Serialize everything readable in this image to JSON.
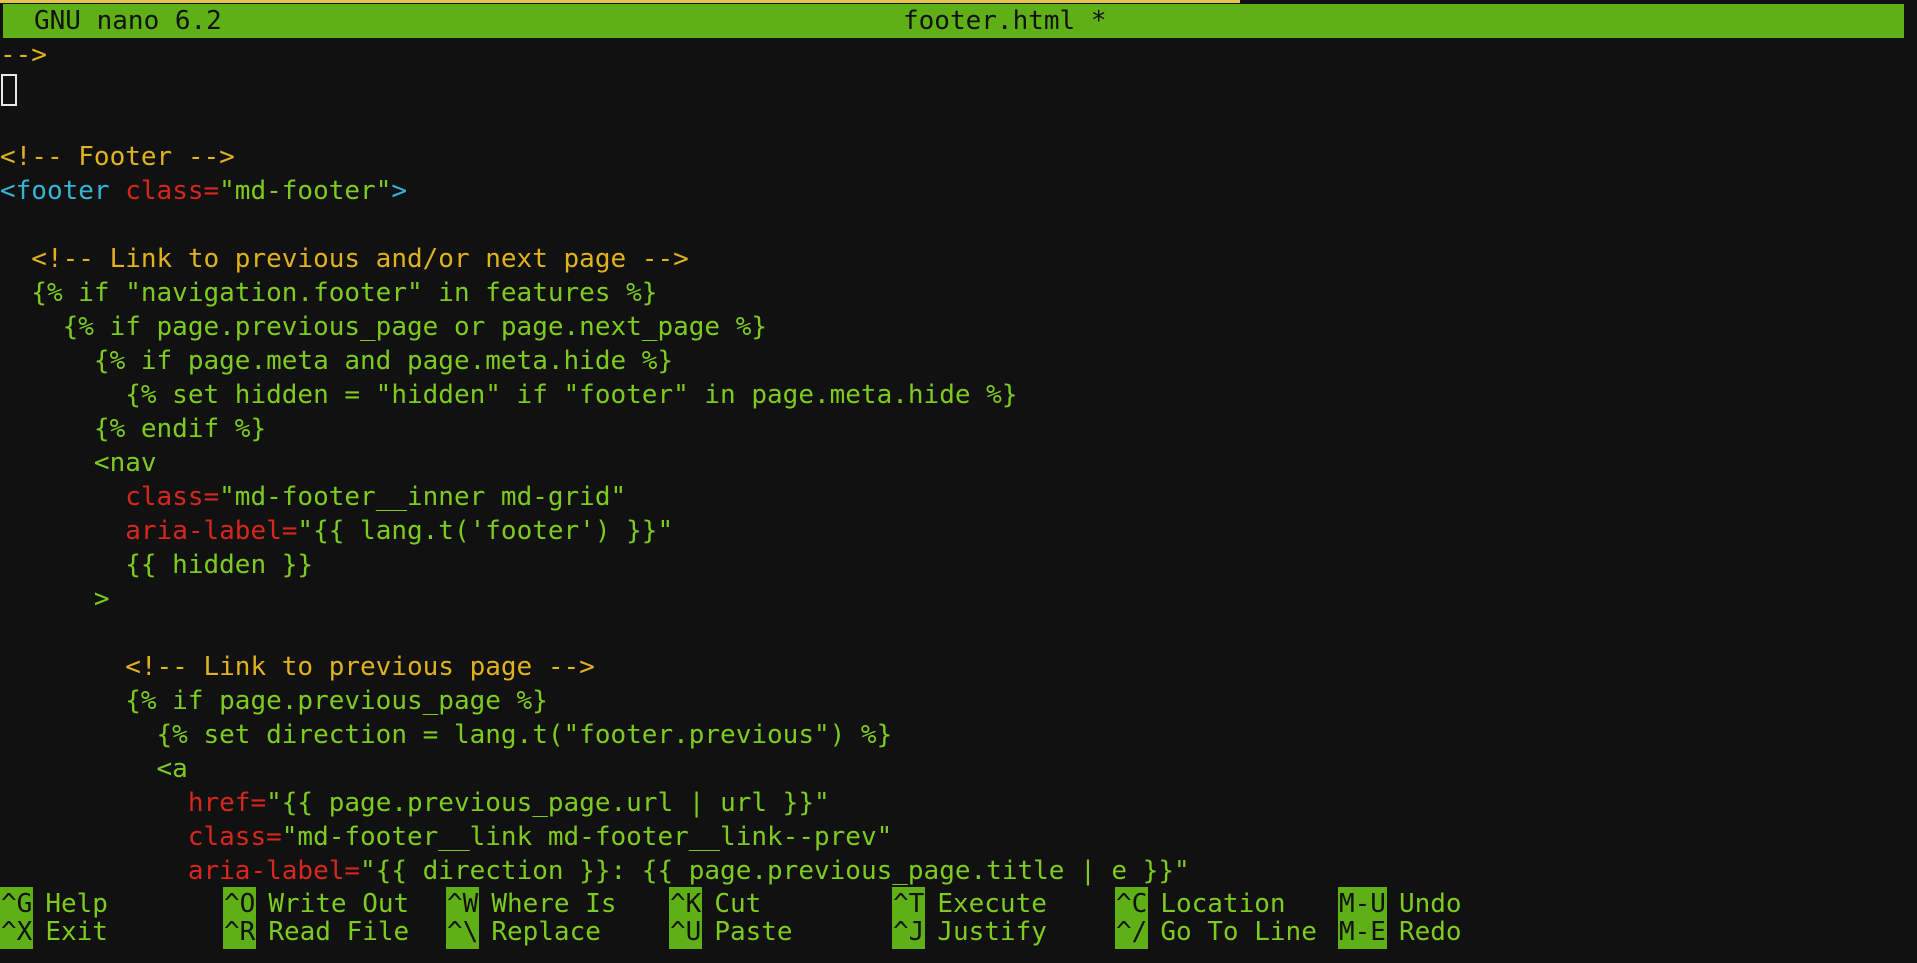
{
  "app": {
    "name": "GNU nano 6.2",
    "filename": "footer.html *"
  },
  "colors": {
    "titlebar_bg": "#5fb017",
    "background": "#111111",
    "plain_text": "#7ecb20",
    "comment": "#e0b21e",
    "tag": "#36b4d6",
    "attribute": "#d7261c",
    "cursor_border": "#e8e8e8"
  },
  "editor": {
    "lines": [
      [
        {
          "t": "-->",
          "c": "comment"
        }
      ],
      [
        {
          "t": "",
          "c": "cursor"
        }
      ],
      [],
      [
        {
          "t": "<!-- Footer -->",
          "c": "comment"
        }
      ],
      [
        {
          "t": "<footer ",
          "c": "tag"
        },
        {
          "t": "class=",
          "c": "attr"
        },
        {
          "t": "\"md-footer\"",
          "c": "plain"
        },
        {
          "t": ">",
          "c": "tag"
        }
      ],
      [],
      [
        {
          "t": "  <!-- Link to previous and/or next page -->",
          "c": "comment"
        }
      ],
      [
        {
          "t": "  {% if \"navigation.footer\" in features %}",
          "c": "plain"
        }
      ],
      [
        {
          "t": "    {% if page.previous_page or page.next_page %}",
          "c": "plain"
        }
      ],
      [
        {
          "t": "      {% if page.meta and page.meta.hide %}",
          "c": "plain"
        }
      ],
      [
        {
          "t": "        {% set hidden = \"hidden\" if \"footer\" in page.meta.hide %}",
          "c": "plain"
        }
      ],
      [
        {
          "t": "      {% endif %}",
          "c": "plain"
        }
      ],
      [
        {
          "t": "      <nav",
          "c": "plain"
        }
      ],
      [
        {
          "t": "        ",
          "c": "plain"
        },
        {
          "t": "class=",
          "c": "attr"
        },
        {
          "t": "\"md-footer__inner md-grid\"",
          "c": "plain"
        }
      ],
      [
        {
          "t": "        ",
          "c": "plain"
        },
        {
          "t": "aria-label=",
          "c": "attr"
        },
        {
          "t": "\"{{ lang.t('footer') }}\"",
          "c": "plain"
        }
      ],
      [
        {
          "t": "        {{ hidden }}",
          "c": "plain"
        }
      ],
      [
        {
          "t": "      >",
          "c": "plain"
        }
      ],
      [],
      [
        {
          "t": "        <!-- Link to previous page -->",
          "c": "comment"
        }
      ],
      [
        {
          "t": "        {% if page.previous_page %}",
          "c": "plain"
        }
      ],
      [
        {
          "t": "          {% set direction = lang.t(\"footer.previous\") %}",
          "c": "plain"
        }
      ],
      [
        {
          "t": "          <a",
          "c": "plain"
        }
      ],
      [
        {
          "t": "            ",
          "c": "plain"
        },
        {
          "t": "href=",
          "c": "attr"
        },
        {
          "t": "\"{{ page.previous_page.url | url }}\"",
          "c": "plain"
        }
      ],
      [
        {
          "t": "            ",
          "c": "plain"
        },
        {
          "t": "class=",
          "c": "attr"
        },
        {
          "t": "\"md-footer__link md-footer__link--prev\"",
          "c": "plain"
        }
      ],
      [
        {
          "t": "            ",
          "c": "plain"
        },
        {
          "t": "aria-label=",
          "c": "attr"
        },
        {
          "t": "\"{{ direction }}: {{ page.previous_page.title | e }}\"",
          "c": "plain"
        }
      ]
    ]
  },
  "shortcuts": [
    {
      "key": "^G",
      "label": "Help"
    },
    {
      "key": "^O",
      "label": "Write Out"
    },
    {
      "key": "^W",
      "label": "Where Is"
    },
    {
      "key": "^K",
      "label": "Cut"
    },
    {
      "key": "^T",
      "label": "Execute"
    },
    {
      "key": "^C",
      "label": "Location"
    },
    {
      "key": "M-U",
      "label": "Undo"
    },
    {
      "key": "^X",
      "label": "Exit"
    },
    {
      "key": "^R",
      "label": "Read File"
    },
    {
      "key": "^\\",
      "label": "Replace"
    },
    {
      "key": "^U",
      "label": "Paste"
    },
    {
      "key": "^J",
      "label": "Justify"
    },
    {
      "key": "^/",
      "label": "Go To Line"
    },
    {
      "key": "M-E",
      "label": "Redo"
    }
  ]
}
